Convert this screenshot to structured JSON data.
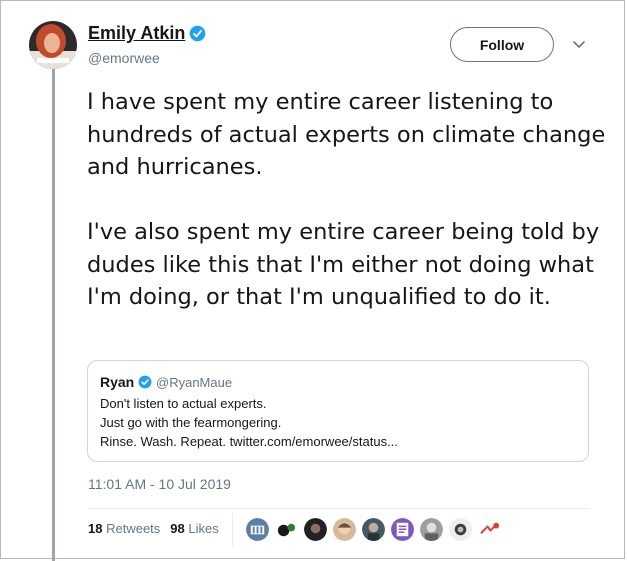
{
  "author": {
    "name": "Emily Atkin",
    "handle": "@emorwee",
    "avatar_icon": "avatar-photo"
  },
  "follow_label": "Follow",
  "tweet": {
    "paragraphs": [
      "I have spent my entire career listening to hundreds of actual experts on climate change and hurricanes.",
      "I've also spent my entire career being told by dudes like this that I'm either not doing what I'm doing, or that I'm unqualified to do it."
    ]
  },
  "quoted_tweet": {
    "name": "Ryan",
    "handle": "@RyanMaue",
    "lines": [
      "Don't listen to actual experts.",
      "Just go with the fearmongering.",
      "Rinse.  Wash.  Repeat. twitter.com/emorwee/status..."
    ]
  },
  "timestamp": "11:01 AM - 10 Jul 2019",
  "stats": {
    "retweets_count": "18",
    "retweets_label": "Retweets",
    "likes_count": "98",
    "likes_label": "Likes"
  },
  "liker_icons": [
    "liker-avatar-1",
    "liker-avatar-2",
    "liker-avatar-3",
    "liker-avatar-4",
    "liker-avatar-5",
    "liker-avatar-6",
    "liker-avatar-7",
    "liker-avatar-8",
    "liker-avatar-9"
  ],
  "colors": {
    "verified": "#1da1f2",
    "secondary_text": "#657786",
    "primary_text": "#14171a"
  }
}
